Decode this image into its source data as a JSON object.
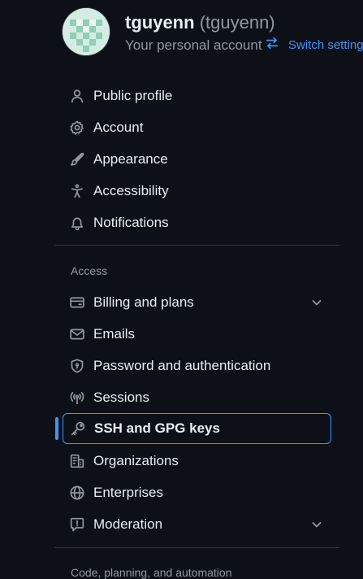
{
  "account": {
    "login": "tguyenn",
    "handle": "(tguyenn)",
    "subtitle": "Your personal account",
    "switch_label": "Switch settings"
  },
  "nav_top": [
    {
      "label": "Public profile",
      "icon": "person-icon"
    },
    {
      "label": "Account",
      "icon": "gear-icon"
    },
    {
      "label": "Appearance",
      "icon": "paintbrush-icon"
    },
    {
      "label": "Accessibility",
      "icon": "accessibility-icon"
    },
    {
      "label": "Notifications",
      "icon": "bell-icon"
    }
  ],
  "sections": {
    "access_heading": "Access",
    "code_heading": "Code, planning, and automation"
  },
  "nav_access": [
    {
      "label": "Billing and plans",
      "icon": "credit-card-icon",
      "expandable": true
    },
    {
      "label": "Emails",
      "icon": "mail-icon"
    },
    {
      "label": "Password and authentication",
      "icon": "shield-lock-icon"
    },
    {
      "label": "Sessions",
      "icon": "broadcast-icon"
    },
    {
      "label": "SSH and GPG keys",
      "icon": "key-icon",
      "active": true
    },
    {
      "label": "Organizations",
      "icon": "organization-icon"
    },
    {
      "label": "Enterprises",
      "icon": "globe-icon"
    },
    {
      "label": "Moderation",
      "icon": "report-icon",
      "expandable": true
    }
  ],
  "colors": {
    "background": "#0d1117",
    "text": "#e6edf3",
    "muted": "#9198a1",
    "accent": "#4493f8",
    "border": "#30363d"
  }
}
